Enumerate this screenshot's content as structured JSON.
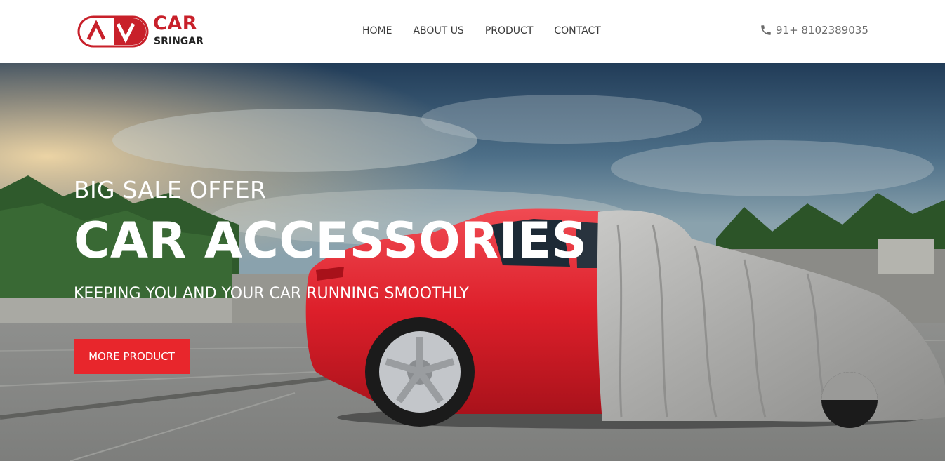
{
  "brand": {
    "badge_text": "AV",
    "name": "CAR",
    "subname": "SRINGAR",
    "color": "#c8202a"
  },
  "nav": {
    "items": [
      {
        "label": "HOME"
      },
      {
        "label": "ABOUT US"
      },
      {
        "label": "PRODUCT"
      },
      {
        "label": "CONTACT"
      }
    ]
  },
  "contact": {
    "phone_icon": "phone-icon",
    "phone": "91+ 8102389035"
  },
  "hero": {
    "eyebrow": "BIG SALE OFFER",
    "headline": "CAR ACCESSORIES",
    "tagline": "KEEPING YOU AND YOUR CAR RUNNING SMOOTHLY",
    "cta_label": "MORE PRODUCT",
    "cta_color": "#e8262c"
  }
}
